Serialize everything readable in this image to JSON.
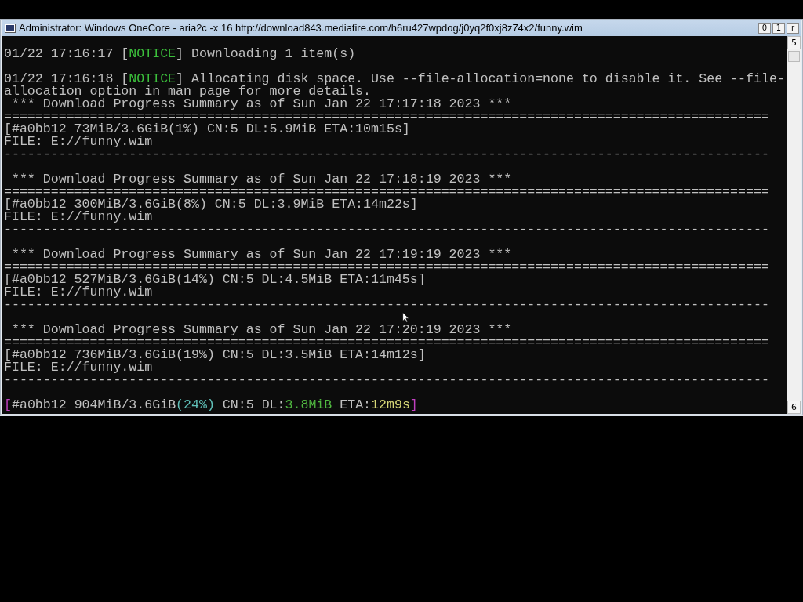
{
  "window": {
    "title": "Administrator:  Windows OneCore - aria2c  -x 16 http://download843.mediafire.com/h6ru427wpdog/j0yq2f0xj8z74x2/funny.wim",
    "buttons": [
      "0",
      "1",
      "r"
    ]
  },
  "scrollbar": {
    "up": "5",
    "down": "6"
  },
  "console": {
    "blocks": [
      {
        "lines": [
          {
            "segments": [
              {
                "text": "01/22 17:16:17 ["
              },
              {
                "text": "NOTICE",
                "color": "#3cc03c"
              },
              {
                "text": "] Downloading 1 item(s)"
              }
            ]
          }
        ]
      },
      {
        "lines": [
          {
            "segments": [
              {
                "text": "01/22 17:16:18 ["
              },
              {
                "text": "NOTICE",
                "color": "#3cc03c"
              },
              {
                "text": "] Allocating disk space. Use --file-allocation=none to disable it. See --file-"
              }
            ]
          },
          {
            "segments": [
              {
                "text": "allocation option in man page for more details."
              }
            ]
          },
          {
            "segments": [
              {
                "text": " *** Download Progress Summary as of Sun Jan 22 17:17:18 2023 ***"
              }
            ]
          },
          {
            "segments": [
              {
                "text": "=================================================================================================="
              }
            ]
          },
          {
            "segments": [
              {
                "text": "[#a0bb12 73MiB/3.6GiB(1%) CN:5 DL:5.9MiB ETA:10m15s]"
              }
            ]
          },
          {
            "segments": [
              {
                "text": "FILE: E://funny.wim"
              }
            ]
          },
          {
            "segments": [
              {
                "text": "--------------------------------------------------------------------------------------------------"
              }
            ]
          }
        ]
      },
      {
        "lines": [
          {
            "segments": [
              {
                "text": " *** Download Progress Summary as of Sun Jan 22 17:18:19 2023 ***"
              }
            ]
          },
          {
            "segments": [
              {
                "text": "=================================================================================================="
              }
            ]
          },
          {
            "segments": [
              {
                "text": "[#a0bb12 300MiB/3.6GiB(8%) CN:5 DL:3.9MiB ETA:14m22s]"
              }
            ]
          },
          {
            "segments": [
              {
                "text": "FILE: E://funny.wim"
              }
            ]
          },
          {
            "segments": [
              {
                "text": "--------------------------------------------------------------------------------------------------"
              }
            ]
          }
        ]
      },
      {
        "lines": [
          {
            "segments": [
              {
                "text": " *** Download Progress Summary as of Sun Jan 22 17:19:19 2023 ***"
              }
            ]
          },
          {
            "segments": [
              {
                "text": "=================================================================================================="
              }
            ]
          },
          {
            "segments": [
              {
                "text": "[#a0bb12 527MiB/3.6GiB(14%) CN:5 DL:4.5MiB ETA:11m45s]"
              }
            ]
          },
          {
            "segments": [
              {
                "text": "FILE: E://funny.wim"
              }
            ]
          },
          {
            "segments": [
              {
                "text": "--------------------------------------------------------------------------------------------------"
              }
            ]
          }
        ]
      },
      {
        "lines": [
          {
            "segments": [
              {
                "text": " *** Download Progress Summary as of Sun Jan 22 17:20:19 2023 ***"
              }
            ]
          },
          {
            "segments": [
              {
                "text": "=================================================================================================="
              }
            ]
          },
          {
            "segments": [
              {
                "text": "[#a0bb12 736MiB/3.6GiB(19%) CN:5 DL:3.5MiB ETA:14m12s]"
              }
            ]
          },
          {
            "segments": [
              {
                "text": "FILE: E://funny.wim"
              }
            ]
          },
          {
            "segments": [
              {
                "text": "--------------------------------------------------------------------------------------------------"
              }
            ]
          }
        ]
      },
      {
        "lines": [
          {
            "segments": [
              {
                "text": "[",
                "color": "#c040c0"
              },
              {
                "text": "#a0bb12 904MiB/3.6GiB"
              },
              {
                "text": "(24%)",
                "color": "#60c0b8"
              },
              {
                "text": " CN:5 DL:"
              },
              {
                "text": "3.8MiB",
                "color": "#50b840"
              },
              {
                "text": " ETA:"
              },
              {
                "text": "12m9s",
                "color": "#d8d878"
              },
              {
                "text": "]",
                "color": "#c040c0"
              }
            ]
          }
        ]
      }
    ]
  }
}
